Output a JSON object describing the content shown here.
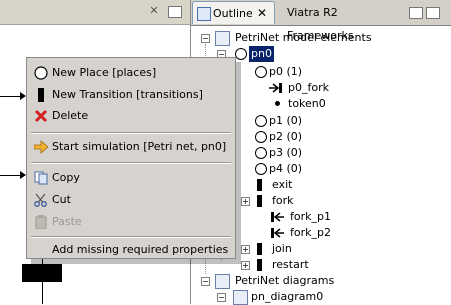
{
  "outline": {
    "tab_label": "Outline",
    "tab_close": "✕",
    "second_tab_label": "Viatra R2 Frameworks"
  },
  "tree": {
    "root": "PetriNet model elements",
    "pn0": "pn0",
    "p0": "p0 (1)",
    "p0_fork": "p0_fork",
    "token0": "token0",
    "p1": "p1 (0)",
    "p2": "p2 (0)",
    "p3": "p3 (0)",
    "p4": "p4 (0)",
    "exit": "exit",
    "fork": "fork",
    "fork_p1": "fork_p1",
    "fork_p2": "fork_p2",
    "join": "join",
    "restart": "restart",
    "diagrams": "PetriNet diagrams",
    "pn_diagram0": "pn_diagram0"
  },
  "menu": {
    "new_place": "New Place [places]",
    "new_transition": "New Transition [transitions]",
    "delete": "Delete",
    "start_simulation": "Start simulation [Petri net, pn0]",
    "copy": "Copy",
    "cut": "Cut",
    "paste": "Paste",
    "add_missing": "Add missing required properties"
  },
  "editor": {
    "close_glyph": "✕"
  },
  "colors": {
    "selection": "#0a246a",
    "menu_bg": "#d6d3ce",
    "delete_icon": "#d42020",
    "simulation_icon": "#e8a020"
  }
}
